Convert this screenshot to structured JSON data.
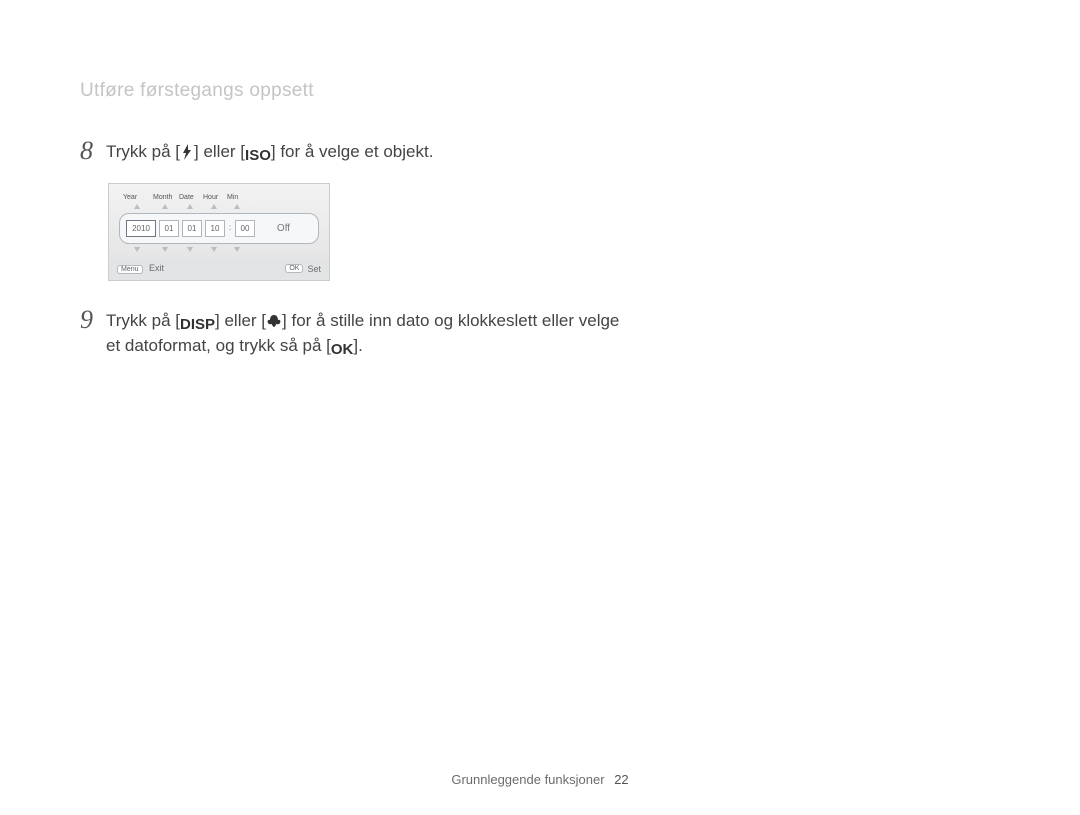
{
  "section_title": "Utføre førstegangs oppsett",
  "steps": {
    "s8": {
      "num": "8",
      "part1": "Trykk på [",
      "part2": "] eller [",
      "part3": "] for å velge et objekt.",
      "icon1_name": "flash-icon",
      "icon2_text": "ISO"
    },
    "s9": {
      "num": "9",
      "part1": "Trykk på [",
      "part2": "] eller [",
      "part3": "] for å stille inn dato og klokkeslett eller velge et datoformat, og trykk så på [",
      "part4": "].",
      "icon1_text": "DISP",
      "icon2_name": "macro-icon",
      "icon3_text": "OK"
    }
  },
  "lcd": {
    "labels": {
      "year": "Year",
      "month": "Month",
      "date": "Date",
      "hour": "Hour",
      "min": "Min"
    },
    "year": "2010",
    "month": "01",
    "date": "01",
    "hour": "10",
    "min": "00",
    "colon": ":",
    "toggle": "Off",
    "footer": {
      "menu_pill": "Menu",
      "exit_label": "Exit",
      "ok_pill": "OK",
      "set_label": "Set"
    }
  },
  "footer": {
    "label": "Grunnleggende funksjoner",
    "page": "22"
  }
}
